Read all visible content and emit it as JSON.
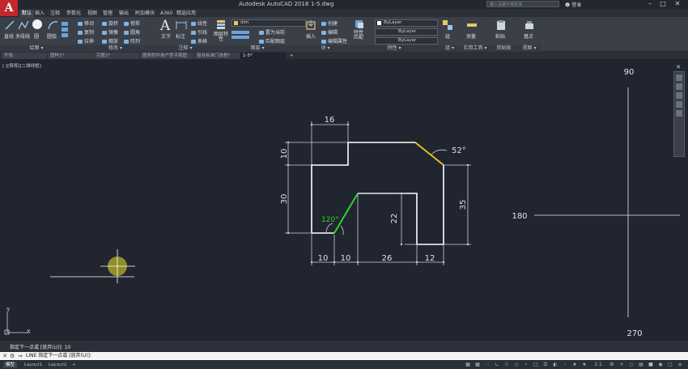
{
  "app": {
    "logo_letter": "A",
    "title": "Autodesk AutoCAD 2018",
    "file_name": "1-5.dwg",
    "search_placeholder": "键入关键字或短语",
    "login_label": "登录"
  },
  "ribbon_tabs": [
    {
      "label": "默认",
      "active": true
    },
    {
      "label": "插入",
      "active": false
    },
    {
      "label": "注释",
      "active": false
    },
    {
      "label": "参数化",
      "active": false
    },
    {
      "label": "视图",
      "active": false
    },
    {
      "label": "管理",
      "active": false
    },
    {
      "label": "输出",
      "active": false
    },
    {
      "label": "附加模块",
      "active": false
    },
    {
      "label": "A360",
      "active": false
    },
    {
      "label": "精选应用",
      "active": false
    }
  ],
  "ribbon": {
    "draw": {
      "line": "直线",
      "polyline": "多段线",
      "circle": "圆",
      "arc": "圆弧"
    },
    "modify": {
      "move": "移动",
      "rotate": "旋转",
      "trim": "修剪",
      "copy": "复制",
      "mirror": "镜像",
      "fillet": "圆角",
      "stretch": "拉伸",
      "scale": "缩放",
      "array": "阵列"
    },
    "annotation": {
      "text": "文字",
      "dimension": "标注",
      "linear": "线性",
      "leader": "引线",
      "table": "表格"
    },
    "layers": {
      "layer_properties": "图层特性",
      "current_layer": "dim",
      "set_current": "置为当前",
      "match_layer": "匹配图层"
    },
    "block": {
      "insert": "插入",
      "create": "创建",
      "edit": "编辑",
      "edit_attributes": "编辑属性"
    },
    "properties": {
      "match": "特性匹配",
      "color": "ByLayer",
      "linetype": "ByLayer",
      "lineweight": "ByLayer"
    },
    "groups": {
      "group": "组"
    },
    "utilities": {
      "measure": "测量"
    },
    "clipboard": {
      "paste": "粘贴"
    },
    "view": {
      "base": "基点"
    }
  },
  "panel_labels": {
    "draw": "绘图 ▾",
    "modify": "修改 ▾",
    "annotation": "注释 ▾",
    "layers": "图层 ▾",
    "block": "块 ▾",
    "properties": "特性 ▾",
    "groups": "组 ▾",
    "utilities": "实用工具 ▾",
    "clipboard": "剪贴板",
    "view": "视图 ▾"
  },
  "file_tabs": [
    {
      "label": "开始",
      "active": false
    },
    {
      "label": "图样1*",
      "active": false
    },
    {
      "label": "完整2*",
      "active": false
    },
    {
      "label": "圆条附件单户型平面图",
      "active": false
    },
    {
      "label": "窗台标准门衣柜*",
      "active": false
    },
    {
      "label": "1-5*",
      "active": true
    }
  ],
  "viewport_label": "[-][俯视][二维线框]",
  "drawing": {
    "dims": {
      "top_width": "16",
      "left_top_height": "10",
      "left_height": "30",
      "bottom_left": "10",
      "bottom_second": "10",
      "bottom_middle": "26",
      "bottom_right": "12",
      "inner_height": "22",
      "right_height": "35",
      "chamfer_angle": "52°",
      "slope_angle": "120°"
    },
    "colors": {
      "outline": "#ffffff",
      "dimension": "#d0d0d0",
      "green_line": "#27d827",
      "yellow_line": "#e6c022",
      "green_text": "#27d827"
    }
  },
  "view_cube": {
    "north": "90",
    "south": "270",
    "west": "180"
  },
  "ucs": {
    "x": "X",
    "y": "Y"
  },
  "command": {
    "history": "指定下一点或 [放弃(U)]: 10",
    "prompt": "LINE 指定下一点或 [放弃(U)]:"
  },
  "layout_tabs": [
    {
      "label": "模型",
      "active": true
    },
    {
      "label": "Layout1",
      "active": false
    },
    {
      "label": "Layout2",
      "active": false
    }
  ],
  "status": {
    "scale": "1:1"
  }
}
